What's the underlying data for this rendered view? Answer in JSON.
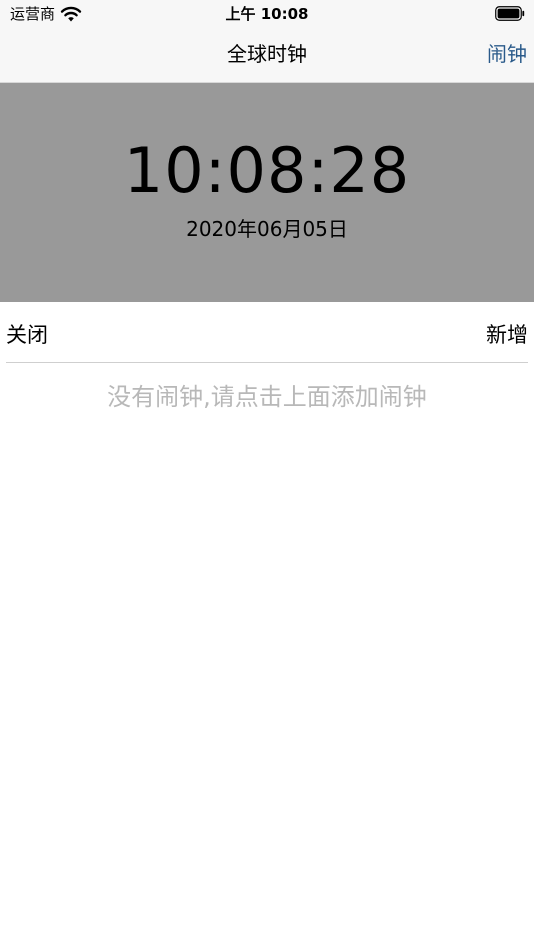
{
  "status_bar": {
    "carrier": "运营商",
    "time": "上午 10:08",
    "wifi_icon": "wifi-icon",
    "battery_icon": "battery-icon"
  },
  "nav": {
    "title": "全球时钟",
    "right_button": "闹钟"
  },
  "clock": {
    "time": "10:08:28",
    "date": "2020年06月05日"
  },
  "toolbar": {
    "close_label": "关闭",
    "add_label": "新增"
  },
  "empty_state": {
    "message": "没有闹钟,请点击上面添加闹钟"
  },
  "colors": {
    "panel_bg": "#999999",
    "nav_bg": "#f7f7f7",
    "accent": "#2a5a8a",
    "placeholder_text": "#b8b8b8"
  }
}
